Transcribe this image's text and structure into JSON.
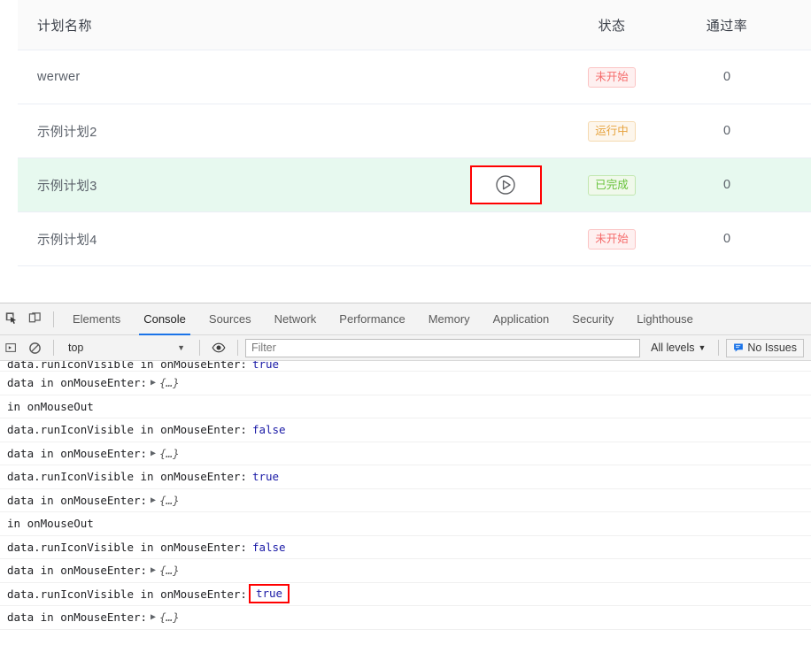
{
  "page": {
    "table": {
      "columns": [
        "计划名称",
        "",
        "状态",
        "通过率"
      ],
      "headers": {
        "name": "计划名称",
        "status": "状态",
        "pass_rate": "通过率"
      },
      "rows": [
        {
          "name": "werwer",
          "status": "未开始",
          "status_color": "red",
          "pass_rate": "0",
          "hovered": false,
          "run_icon_visible": false
        },
        {
          "name": "示例计划2",
          "status": "运行中",
          "status_color": "orange",
          "pass_rate": "0",
          "hovered": false,
          "run_icon_visible": false
        },
        {
          "name": "示例计划3",
          "status": "已完成",
          "status_color": "green",
          "pass_rate": "0",
          "hovered": true,
          "run_icon_visible": true
        },
        {
          "name": "示例计划4",
          "status": "未开始",
          "status_color": "red",
          "pass_rate": "0",
          "hovered": false,
          "run_icon_visible": false
        }
      ],
      "run_icon_name": "play-circle-icon"
    },
    "annotation": {
      "run_icon_box_color": "#ff0000",
      "hover_row_bg": "#e7f9ef"
    }
  },
  "devtools": {
    "toolbar": {
      "inspect_icon": "inspect-element-icon",
      "device_icon": "device-toolbar-icon",
      "tabs": [
        {
          "label": "Elements",
          "active": false
        },
        {
          "label": "Console",
          "active": true
        },
        {
          "label": "Sources",
          "active": false
        },
        {
          "label": "Network",
          "active": false
        },
        {
          "label": "Performance",
          "active": false
        },
        {
          "label": "Memory",
          "active": false
        },
        {
          "label": "Application",
          "active": false
        },
        {
          "label": "Security",
          "active": false
        },
        {
          "label": "Lighthouse",
          "active": false
        }
      ],
      "active_tab_underline": "#1a73e8"
    },
    "filterbar": {
      "sidebar_icon": "console-sidebar-icon",
      "clear_icon": "clear-console-icon",
      "context": "top",
      "context_caret": "▼",
      "eye_icon": "live-expression-eye-icon",
      "filter_placeholder": "Filter",
      "filter_value": "",
      "levels_label": "All levels",
      "levels_caret": "▼",
      "issues_icon": "issues-message-icon",
      "issues_label": "No Issues"
    },
    "console": {
      "lines": [
        {
          "text": "data.runIconVisible in onMouseEnter:",
          "value": "true",
          "kind": "bool",
          "clipped": true,
          "annotated": false
        },
        {
          "text": "data in onMouseEnter:",
          "value": "{…}",
          "kind": "object",
          "clipped": false,
          "annotated": false
        },
        {
          "text": "in onMouseOut",
          "value": "",
          "kind": "none",
          "clipped": false,
          "annotated": false
        },
        {
          "text": "data.runIconVisible in onMouseEnter:",
          "value": "false",
          "kind": "bool",
          "clipped": false,
          "annotated": false
        },
        {
          "text": "data in onMouseEnter:",
          "value": "{…}",
          "kind": "object",
          "clipped": false,
          "annotated": false
        },
        {
          "text": "data.runIconVisible in onMouseEnter:",
          "value": "true",
          "kind": "bool",
          "clipped": false,
          "annotated": false
        },
        {
          "text": "data in onMouseEnter:",
          "value": "{…}",
          "kind": "object",
          "clipped": false,
          "annotated": false
        },
        {
          "text": "in onMouseOut",
          "value": "",
          "kind": "none",
          "clipped": false,
          "annotated": false
        },
        {
          "text": "data.runIconVisible in onMouseEnter:",
          "value": "false",
          "kind": "bool",
          "clipped": false,
          "annotated": false
        },
        {
          "text": "data in onMouseEnter:",
          "value": "{…}",
          "kind": "object",
          "clipped": false,
          "annotated": false
        },
        {
          "text": "data.runIconVisible in onMouseEnter:",
          "value": "true",
          "kind": "bool",
          "clipped": false,
          "annotated": true
        },
        {
          "text": "data in onMouseEnter:",
          "value": "{…}",
          "kind": "object",
          "clipped": false,
          "annotated": false
        }
      ],
      "disclosure_triangle": "▶",
      "bool_color": "#1a1aa6",
      "annotation_color": "#ff0000"
    }
  }
}
